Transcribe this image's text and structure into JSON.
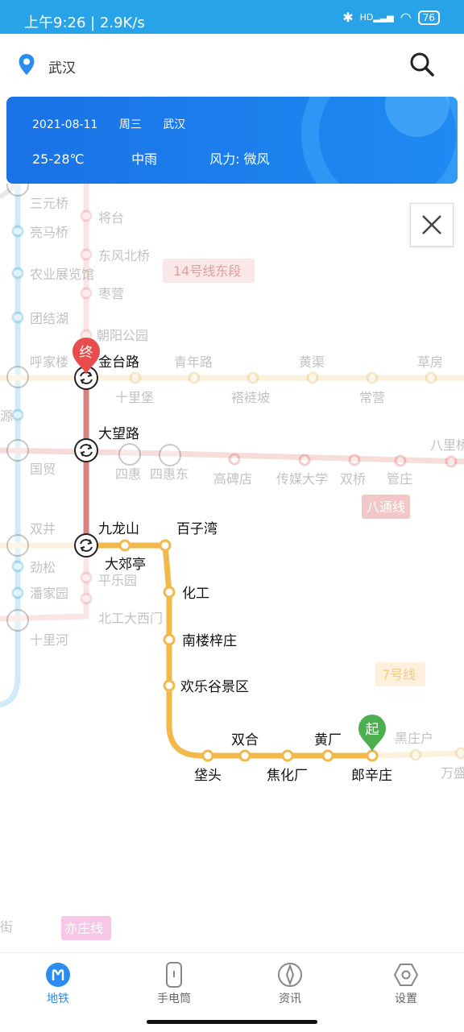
{
  "status_bar": {
    "time": "上午9:26 | 2.9K/s",
    "battery": "76",
    "hd": "HD"
  },
  "location": {
    "city": "武汉"
  },
  "weather": {
    "date": "2021-08-11",
    "weekday": "周三",
    "city": "武汉",
    "temp": "25-28℃",
    "condition": "中雨",
    "wind": "风力: 微风"
  },
  "map": {
    "stations": {
      "sanyuanqiao": "三元桥",
      "liangmaqiao": "亮马桥",
      "nongzhan": "农业展览馆",
      "tuanjiehu": "团结湖",
      "hujialou": "呼家楼",
      "guomao": "国贸",
      "shuangjing": "双井",
      "jinsong": "劲松",
      "panjiayuan": "潘家园",
      "shilihe": "十里河",
      "jie": "街",
      "yuan": "源",
      "jiangtai": "将台",
      "dongfengbeiqiao": "东风北桥",
      "zaoying": "枣营",
      "chaoyanggongyuan": "朝阳公园",
      "jintailu": "金台路",
      "qingnianlu": "青年路",
      "huangqu": "黄渠",
      "caofang": "草房",
      "shilibao": "十里堡",
      "tuoyanpo": "褡裢坡",
      "changying": "常营",
      "dawanglu": "大望路",
      "sihui": "四惠",
      "sihuidong": "四惠东",
      "gaobeidian": "高碑店",
      "chuanmei": "传媒大学",
      "shuangqiao": "双桥",
      "guanzhuang": "管庄",
      "baliqiao": "八里桥",
      "jiulongshan": "九龙山",
      "dajiaoting": "大郊亭",
      "baiziwan": "百子湾",
      "huagong": "化工",
      "nanlouzizhuang": "南楼梓庄",
      "huanlegu": "欢乐谷景区",
      "shuanghe": "双合",
      "huangchang": "黄厂",
      "pu_tou": "垡头",
      "jiaohuachang": "焦化厂",
      "langxinzhuang": "郎辛庄",
      "heizhuanghu": "黑庄户",
      "wansheng": "万盛",
      "pingleyuan": "平乐园",
      "beigongda": "北工大西门"
    },
    "line_labels": {
      "line14": "14号线东段",
      "batong": "八通线",
      "line7": "7号线",
      "yizhuang": "亦庄线"
    },
    "markers": {
      "end": "终",
      "start": "起"
    }
  },
  "tabs": [
    {
      "label": "地铁",
      "icon": "metro-icon"
    },
    {
      "label": "手电筒",
      "icon": "flashlight-icon"
    },
    {
      "label": "资讯",
      "icon": "compass-icon"
    },
    {
      "label": "设置",
      "icon": "gear-icon"
    }
  ],
  "colors": {
    "accent": "#2a8cf0",
    "route": "#f3b84a",
    "start": "#4caf50",
    "end": "#e84c4c"
  }
}
